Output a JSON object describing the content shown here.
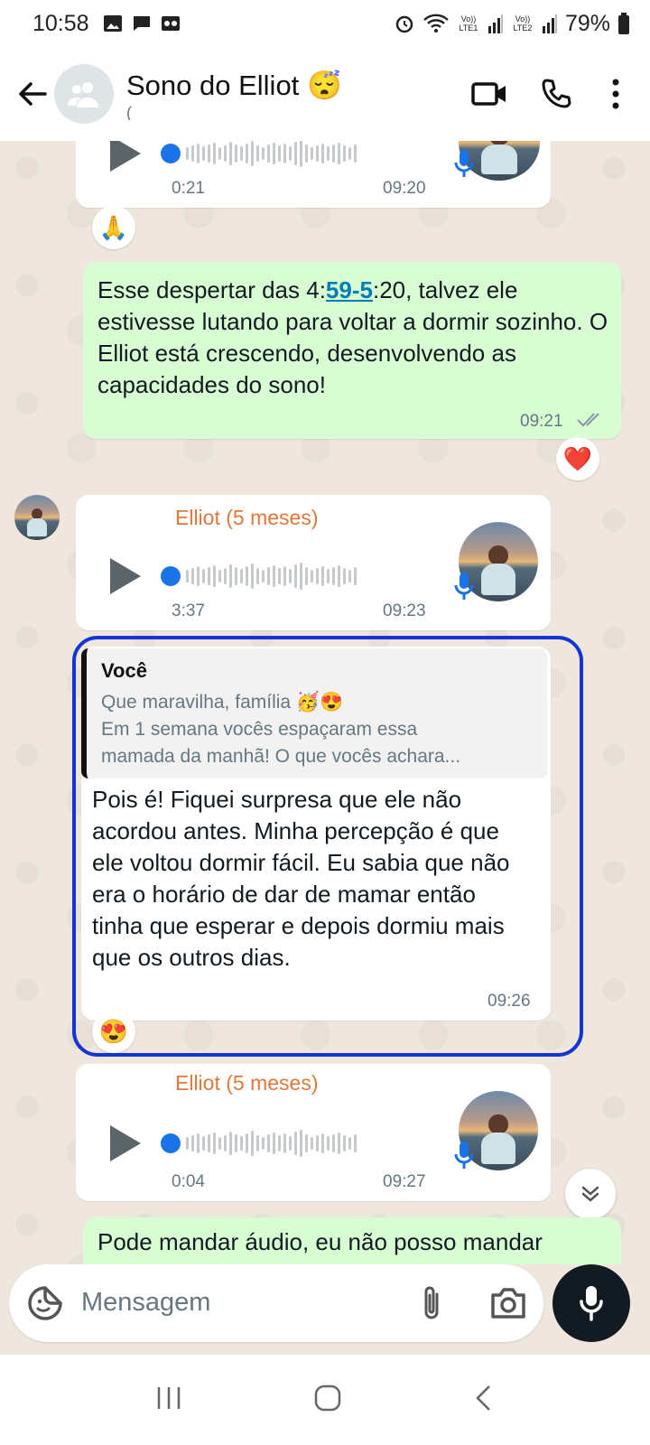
{
  "status_bar": {
    "time": "10:58",
    "lte1": "Vo)) LTE1",
    "lte2": "Vo)) LTE2",
    "battery": "79%"
  },
  "header": {
    "title": "Sono do Elliot",
    "title_emoji": "😴",
    "subtitle": "("
  },
  "messages": {
    "audio1": {
      "duration": "0:21",
      "time": "09:20"
    },
    "reaction1": "🙏",
    "out1": {
      "text_before": "Esse despertar das 4:",
      "link": "59-5",
      "text_after": ":20, talvez ele estivesse lutando para voltar a dormir sozinho. O Elliot está crescendo, desenvolvendo as capacidades do sono!",
      "time": "09:21"
    },
    "reaction2": "❤️",
    "audio2": {
      "sender": "Elliot (5 meses)",
      "duration": "3:37",
      "time": "09:23"
    },
    "reply": {
      "quote_author": "Você",
      "quote_line1": "Que maravilha, família 🥳😍",
      "quote_line2": "Em 1 semana vocês espaçaram essa",
      "quote_line3": "mamada da manhã! O que vocês achara...",
      "text": "Pois é! Fiquei surpresa que ele não acordou antes. Minha percepção é que ele voltou dormir fácil. Eu sabia que não era o horário de dar de mamar então tinha que esperar e depois dormiu mais que os outros dias.",
      "time": "09:26"
    },
    "reaction3": "😍",
    "audio3": {
      "sender": "Elliot (5 meses)",
      "duration": "0:04",
      "time": "09:27"
    },
    "out2_partial": "Pode mandar áudio, eu não posso mandar"
  },
  "input": {
    "placeholder": "Mensagem"
  },
  "colors": {
    "outgoing": "#d9fdd3",
    "incoming": "#ffffff",
    "sender": "#e2773c",
    "link": "#027eb5",
    "highlight": "#1335d4"
  }
}
